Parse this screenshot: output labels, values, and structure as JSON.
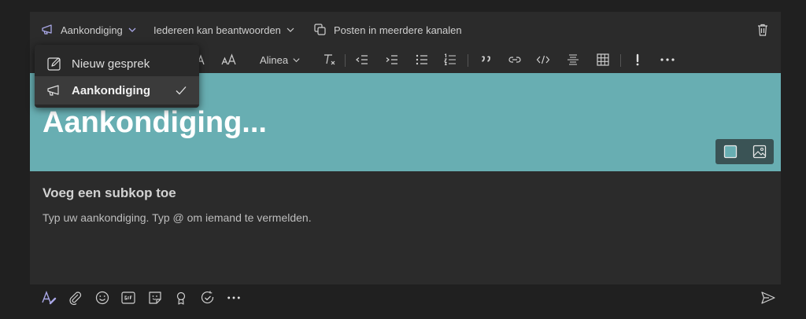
{
  "header": {
    "post_type_label": "Aankondiging",
    "reply_setting_label": "Iedereen kan beantwoorden",
    "crosspost_label": "Posten in meerdere kanalen"
  },
  "toolbar": {
    "paragraph_label": "Alinea"
  },
  "dropdown": {
    "items": [
      {
        "label": "Nieuw gesprek",
        "icon": "edit-icon",
        "selected": false
      },
      {
        "label": "Aankondiging",
        "icon": "megaphone-icon",
        "selected": true
      }
    ]
  },
  "banner": {
    "title": "Aankondiging...",
    "color": "#68aeb2"
  },
  "content": {
    "subheading": "Voeg een subkop toe",
    "body_placeholder": "Typ uw aankondiging. Typ @ om iemand te vermelden."
  },
  "colors": {
    "accent": "#a9a7e6",
    "background": "#202020",
    "composer": "#2b2b2b"
  }
}
